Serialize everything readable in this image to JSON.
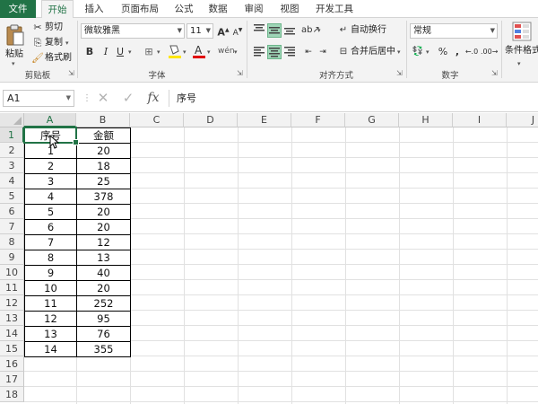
{
  "tabs": [
    "文件",
    "开始",
    "插入",
    "页面布局",
    "公式",
    "数据",
    "审阅",
    "视图",
    "开发工具"
  ],
  "active_tab": "开始",
  "ribbon": {
    "clipboard": {
      "paste": "粘贴",
      "cut": "剪切",
      "copy": "复制",
      "format_painter": "格式刷",
      "group": "剪贴板"
    },
    "font": {
      "name": "微软雅黑",
      "size": "11",
      "bold": "B",
      "italic": "I",
      "underline": "U",
      "group": "字体"
    },
    "alignment": {
      "wrap": "自动换行",
      "merge": "合并后居中",
      "group": "对齐方式"
    },
    "number": {
      "format": "常规",
      "percent": "%",
      "comma": ",",
      "group": "数字"
    },
    "styles": {
      "conditional": "条件格式"
    }
  },
  "formula_bar": {
    "name_box": "A1",
    "cancel": "✕",
    "enter": "✓",
    "fx": "fx",
    "content": "序号"
  },
  "columns": [
    "A",
    "B",
    "C",
    "D",
    "E",
    "F",
    "G",
    "H",
    "I",
    "J"
  ],
  "rows": [
    "1",
    "2",
    "3",
    "4",
    "5",
    "6",
    "7",
    "8",
    "9",
    "10",
    "11",
    "12",
    "13",
    "14",
    "15",
    "16",
    "17",
    "18"
  ],
  "table": {
    "headers": [
      "序号",
      "金额"
    ],
    "data": [
      [
        "1",
        "20"
      ],
      [
        "2",
        "18"
      ],
      [
        "3",
        "25"
      ],
      [
        "4",
        "378"
      ],
      [
        "5",
        "20"
      ],
      [
        "6",
        "20"
      ],
      [
        "7",
        "12"
      ],
      [
        "8",
        "13"
      ],
      [
        "9",
        "40"
      ],
      [
        "10",
        "20"
      ],
      [
        "11",
        "252"
      ],
      [
        "12",
        "95"
      ],
      [
        "13",
        "76"
      ],
      [
        "14",
        "355"
      ]
    ]
  },
  "selected_cell": "A1",
  "colors": {
    "accent": "#217346",
    "file_tab": "#217346"
  }
}
